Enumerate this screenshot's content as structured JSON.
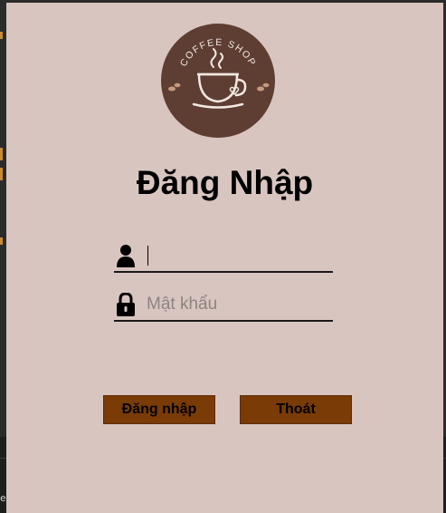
{
  "logo": {
    "text": "COFFEE SHOP",
    "icon": "coffee-cup-icon"
  },
  "title": "Đăng Nhập",
  "username": {
    "value": "",
    "placeholder": "",
    "icon": "user-icon"
  },
  "password": {
    "value": "",
    "placeholder": "Mật khẩu",
    "icon": "lock-icon"
  },
  "buttons": {
    "login": "Đăng nhập",
    "exit": "Thoát"
  },
  "background": {
    "bottom_text": "el"
  },
  "colors": {
    "panel": "#d9c5c0",
    "logo_bg": "#5e3e33",
    "button": "#7a3b06"
  }
}
